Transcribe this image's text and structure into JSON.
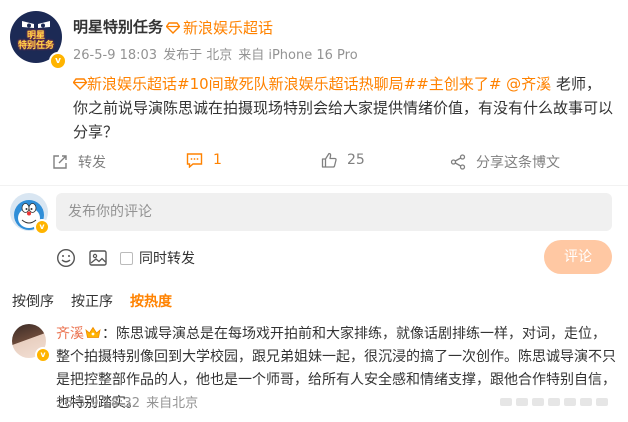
{
  "post": {
    "avatar_text": "明星\n特别任务",
    "author": "明星特别任务",
    "supertopic_tag": "新浪娱乐超话",
    "time": "26-5-9 18:03",
    "source_prefix": "发布于 北京",
    "device": "来自 iPhone 16 Pro",
    "content": {
      "topic_tag": "新浪娱乐超话",
      "hashtag1": "#10间敢死队新浪娱乐超话热聊局#",
      "hashtag2": "#主创来了#",
      "mention": "@齐溪",
      "body": " 老师，你之前说导演陈思诚在拍摄现场特别会给大家提供情绪价值，有没有什么故事可以分享？"
    },
    "actions": {
      "repost": "转发",
      "comment_count": "1",
      "like_count": "25",
      "share": "分享这条博文"
    }
  },
  "composer": {
    "placeholder": "发布你的评论",
    "also_repost": "同时转发",
    "submit": "评论"
  },
  "sort": {
    "reverse": "按倒序",
    "forward": "按正序",
    "hot": "按热度"
  },
  "comment": {
    "author": "齐溪",
    "text": "：陈思诚导演总是在每场戏开拍前和大家排练，就像话剧排练一样，对词，走位，整个拍摄特别像回到大学校园，跟兄弟姐妹一起，很沉浸的搞了一次创作。陈思诚导演不只是把控整部作品的人，他也是一个师哥，给所有人安全感和情绪支撑，跟他合作特别自信，也特别踏实。",
    "time": "26-5-9 18:32",
    "location": "来自北京"
  },
  "colors": {
    "accent": "#ff8200",
    "muted": "#939393",
    "submit_disabled": "#ffc8a3"
  }
}
